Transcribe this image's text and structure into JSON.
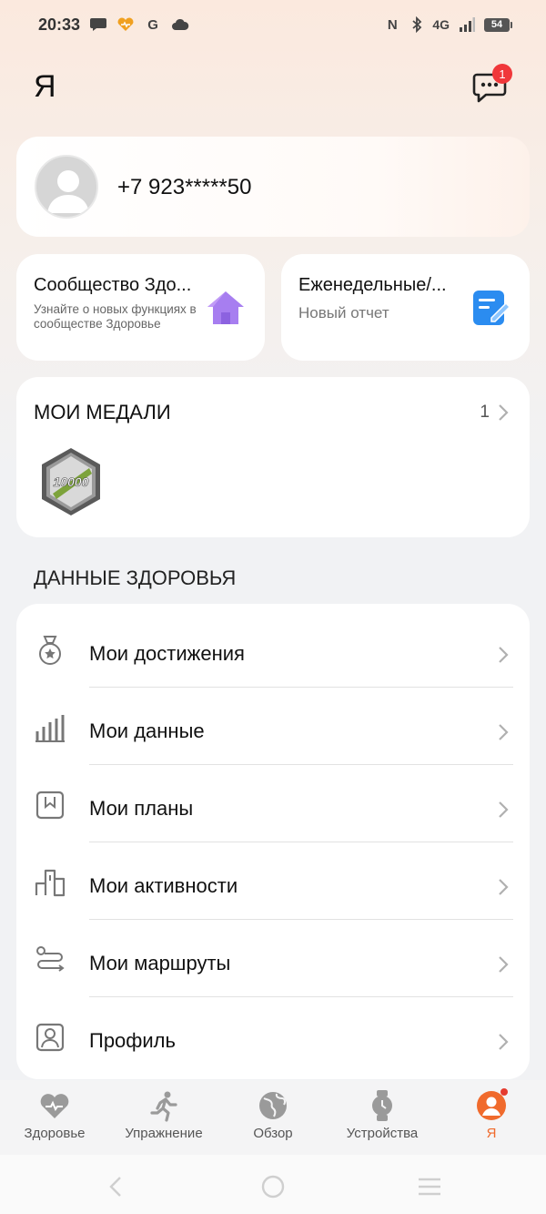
{
  "status_bar": {
    "time": "20:33",
    "network": "4G",
    "battery": "54"
  },
  "header": {
    "title": "Я",
    "messages_badge": "1"
  },
  "profile": {
    "phone": "+7 923*****50"
  },
  "cards": {
    "community": {
      "title": "Сообщество Здо...",
      "subtitle": "Узнайте о новых функциях в сообществе Здоровье"
    },
    "reports": {
      "title": "Еженедельные/...",
      "subtitle": "Новый отчет"
    }
  },
  "medals": {
    "title": "МОИ МЕДАЛИ",
    "count": "1",
    "badge_text": "10000"
  },
  "health_data": {
    "section_title": "ДАННЫЕ ЗДОРОВЬЯ",
    "items": [
      {
        "label": "Мои достижения",
        "icon": "medal-icon"
      },
      {
        "label": "Мои данные",
        "icon": "bar-chart-icon"
      },
      {
        "label": "Мои планы",
        "icon": "plan-icon"
      },
      {
        "label": "Мои активности",
        "icon": "podium-icon"
      },
      {
        "label": "Мои маршруты",
        "icon": "route-icon"
      },
      {
        "label": "Профиль",
        "icon": "profile-icon"
      }
    ]
  },
  "tabs": [
    {
      "label": "Здоровье",
      "icon": "heart-icon",
      "active": false
    },
    {
      "label": "Упражнение",
      "icon": "runner-icon",
      "active": false
    },
    {
      "label": "Обзор",
      "icon": "globe-icon",
      "active": false
    },
    {
      "label": "Устройства",
      "icon": "watch-icon",
      "active": false
    },
    {
      "label": "Я",
      "icon": "user-icon",
      "active": true
    }
  ],
  "colors": {
    "accent": "#f06a2c",
    "badge_red": "#f0373a",
    "icon_gray": "#9a9a9a",
    "community_icon": "#a77ef0",
    "report_icon": "#2b8cf0"
  }
}
